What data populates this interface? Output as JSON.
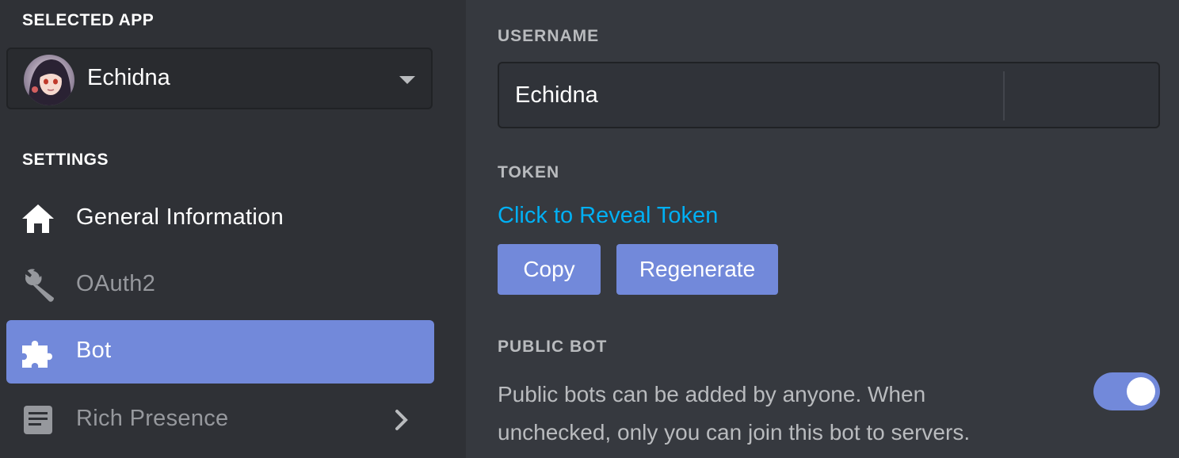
{
  "sidebar": {
    "selected_app_label": "SELECTED APP",
    "app": {
      "name": "Echidna"
    },
    "settings_label": "SETTINGS",
    "items": [
      {
        "label": "General Information",
        "icon": "home-icon"
      },
      {
        "label": "OAuth2",
        "icon": "wrench-icon"
      },
      {
        "label": "Bot",
        "icon": "puzzle-icon",
        "active": true
      },
      {
        "label": "Rich Presence",
        "icon": "document-icon",
        "has_children": true
      }
    ]
  },
  "main": {
    "username_label": "USERNAME",
    "username_value": "Echidna",
    "token_label": "TOKEN",
    "reveal_token": "Click to Reveal Token",
    "copy_button": "Copy",
    "regenerate_button": "Regenerate",
    "public_bot_label": "PUBLIC BOT",
    "public_bot_description": "Public bots can be added by anyone. When unchecked, only you can join this bot to servers.",
    "public_bot_enabled": true
  },
  "colors": {
    "accent": "#7289da",
    "link": "#00b0f4",
    "sidebar_bg": "#2f3136",
    "main_bg": "#36393f"
  }
}
